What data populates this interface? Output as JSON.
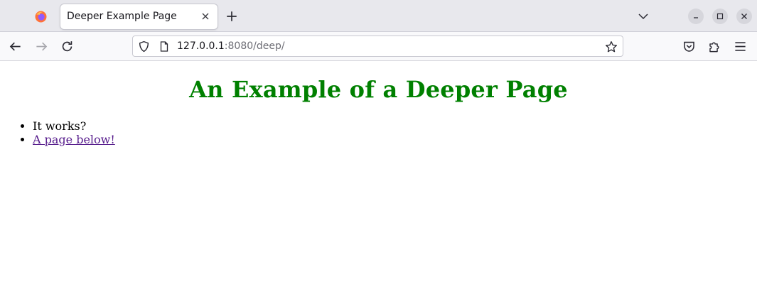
{
  "browser": {
    "tab": {
      "title": "Deeper Example Page"
    },
    "url": {
      "host": "127.0.0.1",
      "rest": ":8080/deep/"
    },
    "colors": {
      "heading": "#008000",
      "visited_link": "#551a8b"
    }
  },
  "page": {
    "heading": "An Example of a Deeper Page",
    "items": [
      {
        "text": "It works?"
      },
      {
        "link_text": "A page below!"
      }
    ]
  }
}
